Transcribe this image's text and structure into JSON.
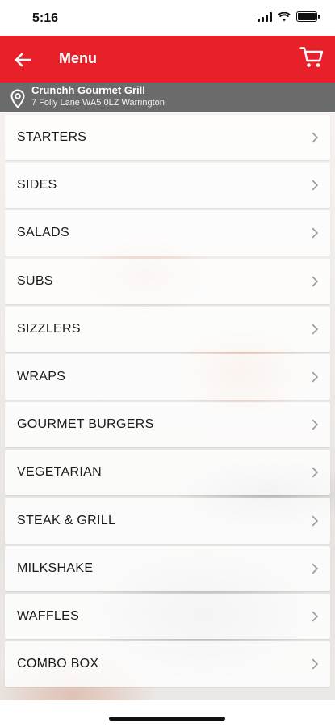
{
  "status": {
    "time": "5:16"
  },
  "header": {
    "title": "Menu"
  },
  "location": {
    "name": "Crunchh Gourmet Grill",
    "address": "7 Folly Lane WA5 0LZ Warrington"
  },
  "menu": {
    "items": [
      {
        "label": "STARTERS"
      },
      {
        "label": "SIDES"
      },
      {
        "label": "SALADS"
      },
      {
        "label": "SUBS"
      },
      {
        "label": "SIZZLERS"
      },
      {
        "label": "WRAPS"
      },
      {
        "label": "GOURMET BURGERS"
      },
      {
        "label": "VEGETARIAN"
      },
      {
        "label": "STEAK & GRILL"
      },
      {
        "label": "MILKSHAKE"
      },
      {
        "label": "WAFFLES"
      },
      {
        "label": "COMBO BOX"
      }
    ]
  },
  "colors": {
    "accent": "#e8202a",
    "location_bar": "#6b6b6b"
  },
  "icons": {
    "back": "arrow-left-icon",
    "cart": "cart-icon",
    "pin": "location-pin-icon",
    "chevron": "chevron-right-icon"
  }
}
